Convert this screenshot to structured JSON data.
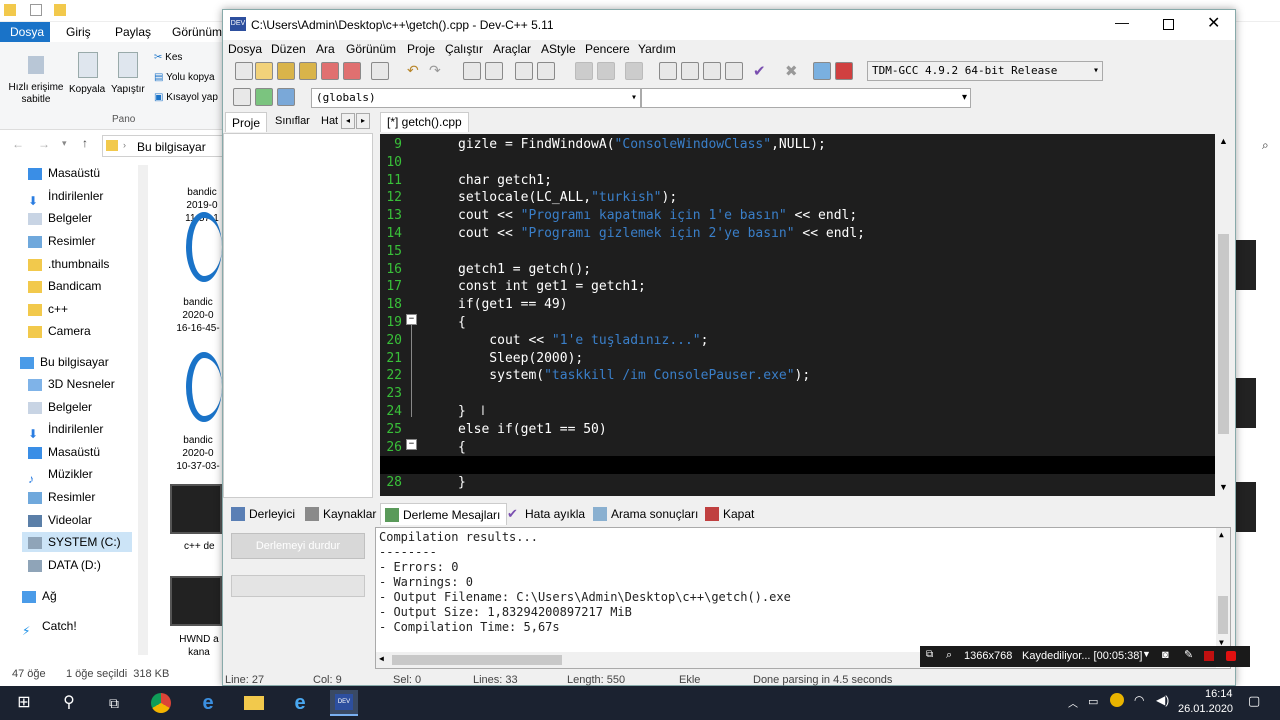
{
  "explorer": {
    "tab_file": "Dosya",
    "tab_home": "Giriş",
    "tab_share": "Paylaş",
    "tab_view": "Görünüm",
    "pin_label": "Hızlı erişime sabitle",
    "copy_label": "Kopyala",
    "paste_label": "Yapıştır",
    "cut_label": "Kes",
    "copy_path_label": "Yolu kopya",
    "shortcut_label": "Kısayol yap",
    "group_label": "Pano",
    "address": "Bu bilgisayar",
    "nav": [
      "Masaüstü",
      "İndirilenler",
      "Belgeler",
      "Resimler",
      ".thumbnails",
      "Bandicam",
      "c++",
      "Camera",
      "Bu bilgisayar",
      "3D Nesneler",
      "Belgeler",
      "İndirilenler",
      "Masaüstü",
      "Müzikler",
      "Resimler",
      "Videolar",
      "SYSTEM (C:)",
      "DATA (D:)",
      "Ağ",
      "Catch!"
    ],
    "status_items": "47 öğe",
    "status_selected": "1 öğe seçildi  318 KB",
    "file_labels": [
      "bandic",
      "2019-0",
      "11-57-1",
      "bandic",
      "2020-0",
      "16-16-45-",
      "bandic",
      "2020-0",
      "10-37-03-",
      "c++ de",
      "HWND a",
      "kana"
    ]
  },
  "dev": {
    "title": "C:\\Users\\Admin\\Desktop\\c++\\getch().cpp - Dev-C++ 5.11",
    "menu": [
      "Dosya",
      "Düzen",
      "Ara",
      "Görünüm",
      "Proje",
      "Çalıştır",
      "Araçlar",
      "AStyle",
      "Pencere",
      "Yardım"
    ],
    "compiler": "TDM-GCC 4.9.2 64-bit Release",
    "scope": "(globals)",
    "left_tabs": [
      "Proje",
      "Sınıflar",
      "Hat"
    ],
    "file_tab": "[*] getch().cpp",
    "bottom_tabs": [
      "Derleyici",
      "Kaynaklar",
      "Derleme Mesajları",
      "Hata ayıkla",
      "Arama sonuçları",
      "Kapat"
    ],
    "abort_button": "Derlemeyi durdur",
    "output_lines": [
      "Compilation results...",
      "--------",
      "- Errors: 0",
      "- Warnings: 0",
      "- Output Filename: C:\\Users\\Admin\\Desktop\\c++\\getch().exe",
      "- Output Size: 1,83294200897217 MiB",
      "- Compilation Time: 5,67s"
    ],
    "code": [
      {
        "n": "9",
        "pre": "gizle = FindWindowA(",
        "str": "\"ConsoleWindowClass\"",
        "post": ",NULL);"
      },
      {
        "n": "10",
        "pre": "",
        "str": "",
        "post": ""
      },
      {
        "n": "11",
        "pre": "char getch1;",
        "str": "",
        "post": ""
      },
      {
        "n": "12",
        "pre": "setlocale(LC_ALL,",
        "str": "\"turkish\"",
        "post": ");"
      },
      {
        "n": "13",
        "pre": "cout << ",
        "str": "\"Programı kapatmak için 1'e basın\"",
        "post": " << endl;"
      },
      {
        "n": "14",
        "pre": "cout << ",
        "str": "\"Programı gizlemek için 2'ye basın\"",
        "post": " << endl;"
      },
      {
        "n": "15",
        "pre": "",
        "str": "",
        "post": ""
      },
      {
        "n": "16",
        "pre": "getch1 = getch();",
        "str": "",
        "post": ""
      },
      {
        "n": "17",
        "pre": "const int get1 = getch1;",
        "str": "",
        "post": ""
      },
      {
        "n": "18",
        "pre": "if(get1 == 49)",
        "str": "",
        "post": ""
      },
      {
        "n": "19",
        "pre": "{",
        "str": "",
        "post": ""
      },
      {
        "n": "20",
        "pre": "    cout << ",
        "str": "\"1'e tuşladınız...\"",
        "post": ";"
      },
      {
        "n": "21",
        "pre": "    Sleep(2000);",
        "str": "",
        "post": ""
      },
      {
        "n": "22",
        "pre": "    system(",
        "str": "\"taskkill /im ConsolePauser.exe\"",
        "post": ");"
      },
      {
        "n": "23",
        "pre": "",
        "str": "",
        "post": ""
      },
      {
        "n": "24",
        "pre": "}",
        "str": "",
        "post": ""
      },
      {
        "n": "25",
        "pre": "else if(get1 == 50)",
        "str": "",
        "post": ""
      },
      {
        "n": "26",
        "pre": "{",
        "str": "",
        "post": ""
      },
      {
        "n": "27",
        "pre": "",
        "str": "",
        "post": ""
      },
      {
        "n": "28",
        "pre": "}",
        "str": "",
        "post": ""
      }
    ],
    "status": [
      "Line: 27",
      "Col: 9",
      "Sel: 0",
      "Lines: 33",
      "Length: 550",
      "Ekle",
      "Done parsing in 4.5 seconds"
    ]
  },
  "recorder": {
    "resolution": "1366x768",
    "status": "Kaydediliyor... [00:05:38]"
  },
  "taskbar": {
    "time": "16:14",
    "date": "26.01.2020"
  },
  "colors": {
    "code_bg": "#1e1e1e",
    "line_number": "#39c039",
    "string": "#3a7fc9",
    "taskbar": "#1b2230"
  }
}
